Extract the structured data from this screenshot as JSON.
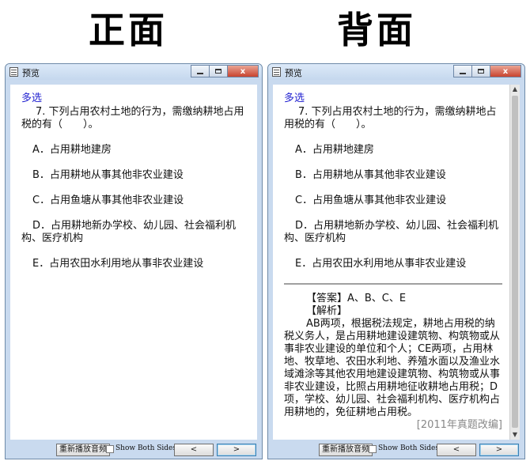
{
  "headings": {
    "front": "正面",
    "back": "背面"
  },
  "window": {
    "title": "预览",
    "close_glyph": "x",
    "replay_button": "重新播放音频",
    "show_both_sides_label": "Show Both Sides",
    "prev_glyph": "<",
    "next_glyph": ">"
  },
  "card": {
    "type_label": "多选",
    "question": "7. 下列占用农村土地的行为，需缴纳耕地占用税的有（　　）。",
    "options": [
      "A．占用耕地建房",
      "B．占用耕地从事其他非农业建设",
      "C．占用鱼塘从事其他非农业建设",
      "D．占用耕地新办学校、幼儿园、社会福利机构、医疗机构",
      "E．占用农田水利用地从事非农业建设"
    ]
  },
  "answer": {
    "answer_line": "【答案】A、B、C、E",
    "analysis_label": "【解析】",
    "explanation": "AB两项，根据税法规定，耕地占用税的纳税义务人，是占用耕地建设建筑物、构筑物或从事非农业建设的单位和个人；CE两项，占用林地、牧草地、农田水利地、养殖水面以及渔业水域滩涂等其他农用地建设建筑物、构筑物或从事非农业建设，比照占用耕地征收耕地占用税；D项，学校、幼儿园、社会福利机构、医疗机构占用耕地的，免征耕地占用税。",
    "cut_off_footer": "[2011年真题改编]"
  }
}
